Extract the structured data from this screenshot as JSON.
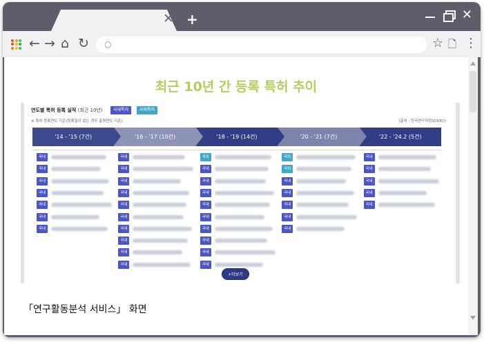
{
  "browser": {
    "tab_close": "✕",
    "new_tab": "+",
    "window_controls": {
      "close": "✕"
    },
    "toolbar": {
      "back": "←",
      "forward": "→",
      "home": "⌂",
      "reload": "↻",
      "search_icon": "○",
      "star": "☆",
      "page": "🗋",
      "menu": "⋮"
    },
    "app_dots_colors": [
      "#e74c3c",
      "#f39c12",
      "#2ecc71",
      "#e74c3c",
      "#f1c40f",
      "#27ae60",
      "#e67e22",
      "#f1c40f",
      "#2ecc71"
    ]
  },
  "page": {
    "heading": "최근 10년 간 등록 특허 추이",
    "caption": "「연구활동분석 서비스」 화면"
  },
  "screenshot": {
    "title": "연도별 특허 등록 실적",
    "title_sub": "(최근 10년)",
    "badge_domestic": "국내특허",
    "badge_foreign": "국외특허",
    "note": "※ 특허 등록연도 기준(등록일이 없는 경우 출원연도 기준)",
    "source": "(출처 : 한국연구자정보(KRI))",
    "periods": [
      {
        "label": "'14 - '15 (7건)",
        "color": "#3b4a8c",
        "count": 7
      },
      {
        "label": "'16 - '17 (10건)",
        "color": "#8c93b6",
        "count": 10
      },
      {
        "label": "'18 - '19 (14건)",
        "color": "#2f3e85",
        "count": 14
      },
      {
        "label": "'20 - '21 (7건)",
        "color": "#7e85ad",
        "count": 7
      },
      {
        "label": "'22 - '24.2 (5건)",
        "color": "#2f3e85",
        "count": 5
      }
    ],
    "tag_domestic": "국내",
    "tag_foreign": "국외",
    "columns": [
      [
        "국내",
        "국내",
        "국내",
        "국내",
        "국내",
        "국내",
        "국내"
      ],
      [
        "국내",
        "국내",
        "국내",
        "국내",
        "국내",
        "국내",
        "국내",
        "국내",
        "국내",
        "국내"
      ],
      [
        "국외",
        "국내",
        "국내",
        "국내",
        "국내",
        "국내",
        "국내",
        "국내",
        "국내",
        "국내"
      ],
      [
        "국외",
        "국외",
        "국내",
        "국내",
        "국내",
        "국내",
        "국내"
      ],
      [
        "국내",
        "국내",
        "국내",
        "국내",
        "국내"
      ]
    ],
    "more_button": "+더보기",
    "colors": {
      "domestic": "#4a56c4",
      "foreign": "#3fa7c8"
    }
  }
}
